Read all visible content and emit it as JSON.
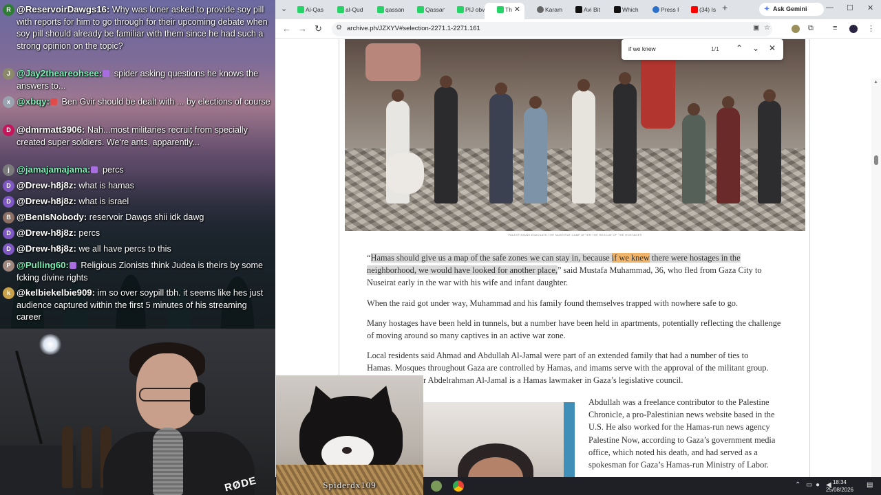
{
  "chat": {
    "messages": [
      {
        "user": "@ReservoirDawgs16:",
        "avatar": "R",
        "badge": false,
        "text": "Why was loner asked to provide soy pill with reports for him to go through for their upcoming debate when soy pill should already be familiar with them since he had such a strong opinion on the topic?"
      },
      {
        "user": "@Jay2theareohsee:",
        "avatar": "J",
        "badge": true,
        "text": "spider asking questions he knows the answers to..."
      },
      {
        "user": "@xbqy:",
        "avatar": "x",
        "badge": true,
        "text": "Ben Gvir should be dealt with ... by elections of course"
      },
      {
        "user": "@dmrmatt3906:",
        "avatar": "D",
        "badge": false,
        "text": "Nah...most militaries recruit from specially created super soldiers. We're ants, apparently..."
      },
      {
        "user": "@jamajamajama:",
        "avatar": "j",
        "badge": true,
        "text": "percs"
      },
      {
        "user": "@Drew-h8j8z:",
        "avatar": "D",
        "badge": false,
        "text": "what is hamas"
      },
      {
        "user": "@Drew-h8j8z:",
        "avatar": "D",
        "badge": false,
        "text": "what is israel"
      },
      {
        "user": "@BenIsNobody:",
        "avatar": "B",
        "badge": false,
        "text": "reservoir Dawgs shii idk dawg"
      },
      {
        "user": "@Drew-h8j8z:",
        "avatar": "D",
        "badge": false,
        "text": "percs"
      },
      {
        "user": "@Drew-h8j8z:",
        "avatar": "D",
        "badge": false,
        "text": "we all have percs to this"
      },
      {
        "user": "@Pulling60:",
        "avatar": "P",
        "badge": true,
        "text": "Religious Zionists think Judea is theirs by some fcking divine rights"
      },
      {
        "user": "@kelbiekelbie909:",
        "avatar": "k",
        "badge": false,
        "text": "im so over soypill tbh. it seems like hes just audience captured within the first 5 minutes of his streaming career"
      }
    ]
  },
  "webcam": {
    "mic_brand": "RØDE"
  },
  "catcam": {
    "name": "Spiderdx109"
  },
  "browser": {
    "tabs": [
      "Al-Qas",
      "al-Qud",
      "qassan",
      "Qassan",
      "PIJ obv",
      "Th",
      "Karam",
      "Avi Bit",
      "Which",
      "Press R",
      "(34) Is"
    ],
    "ask_gemini": "Ask Gemini",
    "url": "archive.ph/JZXYV#selection-2271.1-2271.161",
    "find": {
      "query": "if we knew",
      "count": "1/1"
    }
  },
  "article": {
    "caption": "PALESTINIANS EVACUATE THE NUSEIRAT CAMP AFTER THE RESCUE OF THE HOSTAGES",
    "quote_selected_1": "Hamas should give us a map of the safe zones we can stay in, because ",
    "quote_hit": "if we knew",
    "quote_selected_2": " there were hostages in the",
    "quote_selected_3": "neighborhood, we would have looked for another place,",
    "quote_rest": "” said Mustafa Muhammad, 36, who fled from Gaza City to Nuseirat early in the war with his wife and infant daughter.",
    "open_quote": "“",
    "p2": "When the raid got under way, Muhammad and his family found themselves trapped with nowhere safe to go.",
    "p3": "Many hostages have been held in tunnels, but a number have been held in apartments, potentially reflecting the challenge of moving around so many captives in an active war zone.",
    "p4_line1": "Local residents said Ahmad and Abdullah Al-Jamal were part of an extended family that had a number of ties to",
    "p4_line2": "Hamas. Mosques throughout Gaza are controlled by Hamas, and imams serve with the approval of the militant group.",
    "p4_line3": "r Abdelrahman Al-Jamal is a Hamas lawmaker in Gaza’s legislative council.",
    "p5": "Abdullah was a freelance contributor to the Palestine Chronicle, a pro-Palestinian news website based in the U.S. He also worked for the Hamas-run news agency Palestine Now, according to Gaza’s government media office, which noted his death, and had served as a spokesman for Gaza’s Hamas-run Ministry of Labor."
  },
  "taskbar": {
    "time": "18:34",
    "date": "25/08/2026"
  }
}
